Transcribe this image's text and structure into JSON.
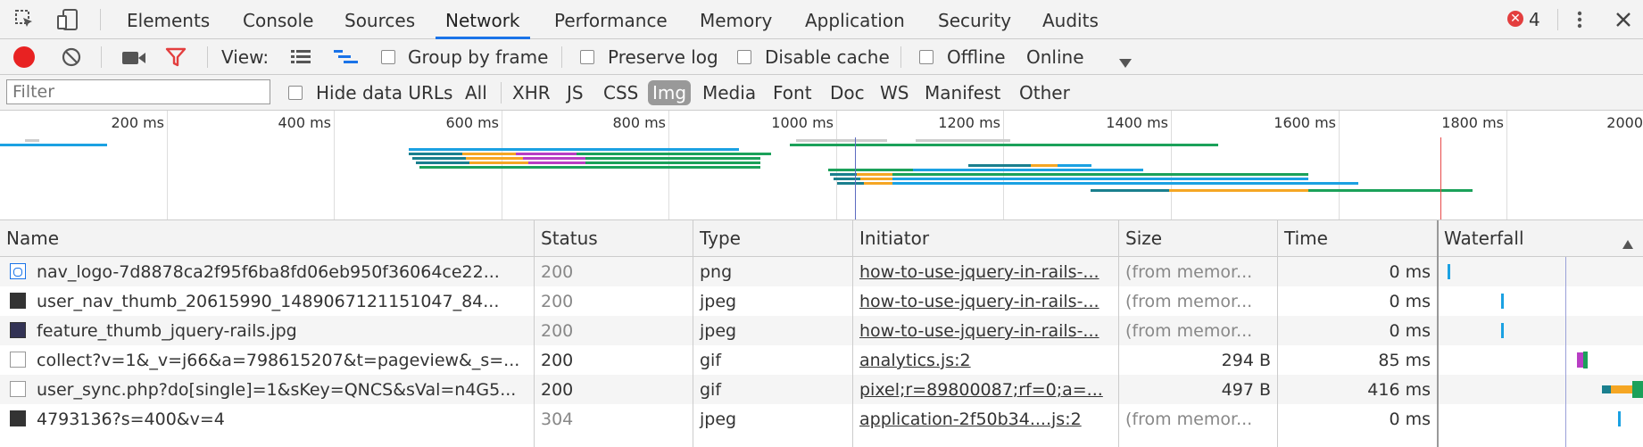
{
  "tabbar": {
    "tabs": [
      "Elements",
      "Console",
      "Sources",
      "Network",
      "Performance",
      "Memory",
      "Application",
      "Security",
      "Audits"
    ],
    "active": "Network",
    "error_count": "4",
    "colors": {
      "active_underline": "#1a73e8",
      "error_badge": "#e33e3e"
    }
  },
  "toolbar": {
    "view_label": "View:",
    "group_by_frame": "Group by frame",
    "preserve_log": "Preserve log",
    "disable_cache": "Disable cache",
    "offline": "Offline",
    "throttle": "Online",
    "colors": {
      "record": "#e82222",
      "filter_icon": "#e33e3e"
    }
  },
  "filterbar": {
    "placeholder": "Filter",
    "hide_data_urls": "Hide data URLs",
    "types": [
      "All",
      "XHR",
      "JS",
      "CSS",
      "Img",
      "Media",
      "Font",
      "Doc",
      "WS",
      "Manifest",
      "Other"
    ],
    "selected_type": "Img"
  },
  "overview": {
    "ticks": [
      "200 ms",
      "400 ms",
      "600 ms",
      "800 ms",
      "1000 ms",
      "1200 ms",
      "1400 ms",
      "1600 ms",
      "1800 ms",
      "2000"
    ]
  },
  "table": {
    "columns": [
      "Name",
      "Status",
      "Type",
      "Initiator",
      "Size",
      "Time",
      "Waterfall"
    ],
    "rows": [
      {
        "name": "nav_logo-7d8878ca2f95f6ba8fd06eb950f36064ce22...",
        "status": "200",
        "type": "png",
        "initiator": "how-to-use-jquery-in-rails-...",
        "size": "(from memor...",
        "time": "0 ms",
        "icon": "image-icon"
      },
      {
        "name": "user_nav_thumb_20615990_1489067121151047_84...",
        "status": "200",
        "type": "jpeg",
        "initiator": "how-to-use-jquery-in-rails-...",
        "size": "(from memor...",
        "time": "0 ms",
        "icon": "image-icon"
      },
      {
        "name": "feature_thumb_jquery-rails.jpg",
        "status": "200",
        "type": "jpeg",
        "initiator": "how-to-use-jquery-in-rails-...",
        "size": "(from memor...",
        "time": "0 ms",
        "icon": "image-icon"
      },
      {
        "name": "collect?v=1&_v=j66&a=798615207&t=pageview&_s=...",
        "status": "200",
        "type": "gif",
        "initiator": "analytics.js:2",
        "size": "294 B",
        "time": "85 ms",
        "icon": "file-icon"
      },
      {
        "name": "user_sync.php?do[single]=1&sKey=QNCS&sVal=n4G5...",
        "status": "200",
        "type": "gif",
        "initiator": "pixel;r=89800087;rf=0;a=...",
        "size": "497 B",
        "time": "416 ms",
        "icon": "file-icon"
      },
      {
        "name": "4793136?s=400&v=4",
        "status": "304",
        "type": "jpeg",
        "initiator": "application-2f50b34....js:2",
        "size": "(from memor...",
        "time": "0 ms",
        "icon": "image-icon"
      }
    ]
  }
}
